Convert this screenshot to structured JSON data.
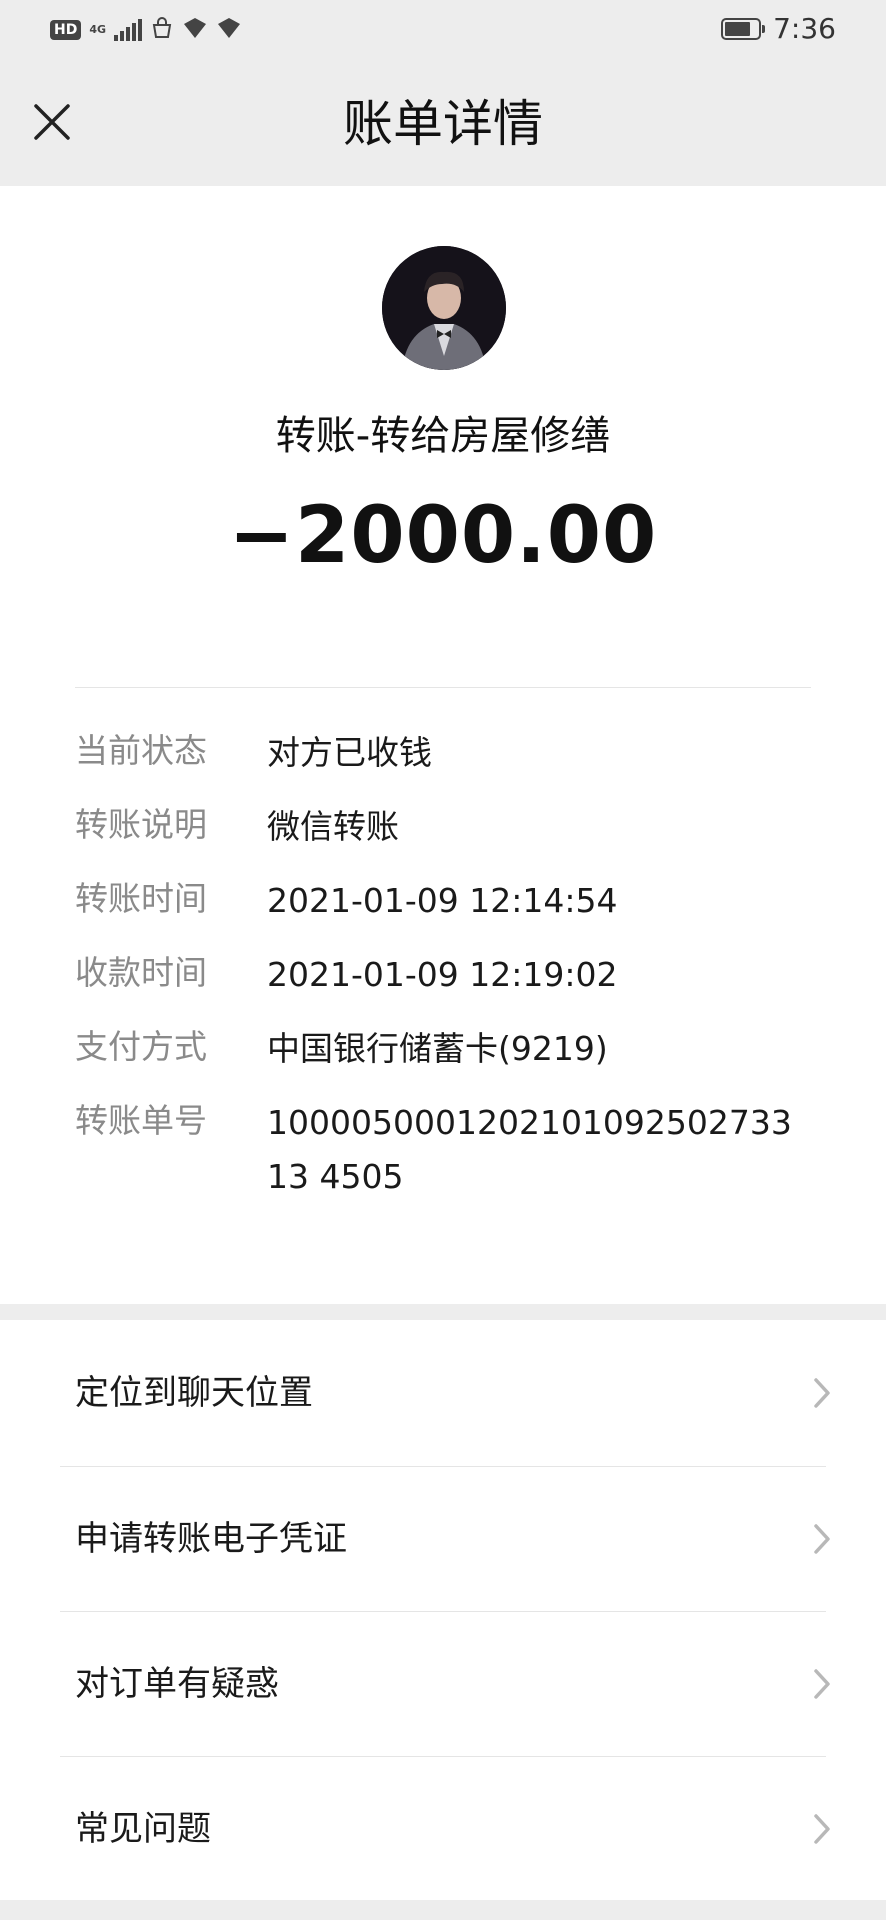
{
  "status_bar": {
    "left_badge": "HD",
    "network": "4G",
    "time": "7:36"
  },
  "nav": {
    "title": "账单详情",
    "close_icon": "close-icon"
  },
  "transaction": {
    "title": "转账-转给房屋修缮",
    "amount": "−2000.00"
  },
  "details": [
    {
      "label": "当前状态",
      "value": "对方已收钱"
    },
    {
      "label": "转账说明",
      "value": "微信转账"
    },
    {
      "label": "转账时间",
      "value": "2021-01-09 12:14:54"
    },
    {
      "label": "收款时间",
      "value": "2021-01-09 12:19:02"
    },
    {
      "label": "支付方式",
      "value": "中国银行储蓄卡(9219)"
    },
    {
      "label": "转账单号",
      "value": "100005000120210109250273313 4505"
    }
  ],
  "menu": [
    {
      "label": "定位到聊天位置"
    },
    {
      "label": "申请转账电子凭证"
    },
    {
      "label": "对订单有疑惑"
    },
    {
      "label": "常见问题"
    }
  ],
  "colors": {
    "page_bg": "#ededed",
    "card_bg": "#ffffff",
    "label_gray": "#8a8a8a",
    "text": "#111111"
  }
}
